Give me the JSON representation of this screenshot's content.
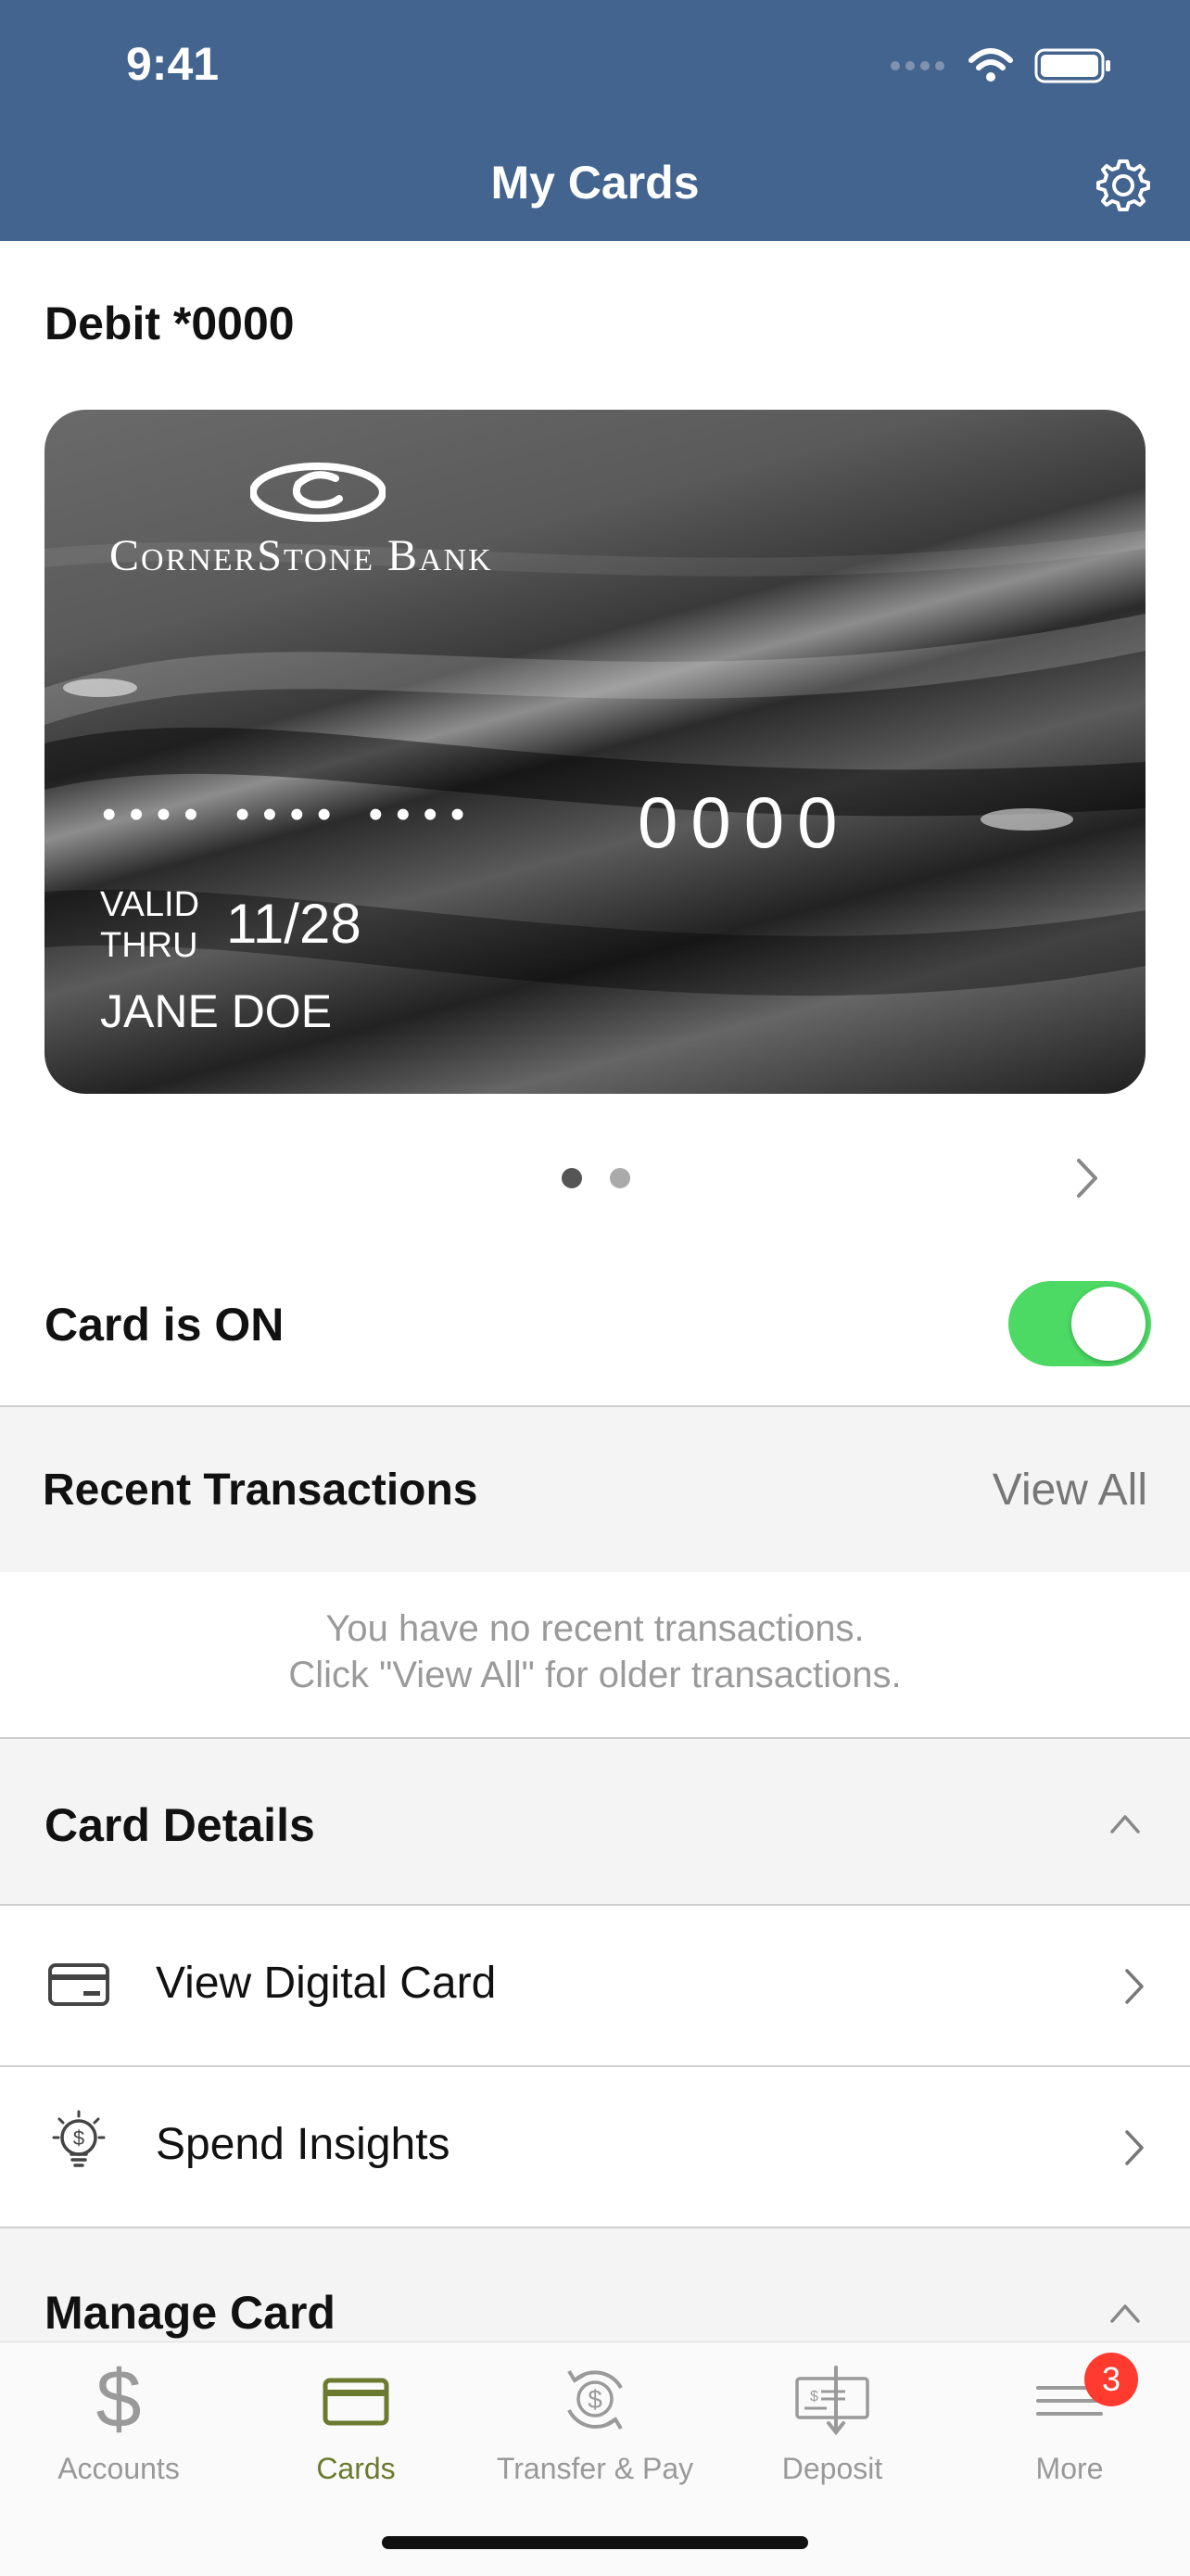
{
  "status_bar": {
    "time": "9:41"
  },
  "header": {
    "title": "My Cards"
  },
  "card": {
    "label": "Debit *0000",
    "bank_name": "CornerStone Bank",
    "number_mask": "•••• •••• ••••",
    "last4": "0000",
    "valid_label_1": "VALID",
    "valid_label_2": "THRU",
    "expiry": "11/28",
    "cardholder": "JANE DOE",
    "pager": {
      "count": 2,
      "active_index": 0
    }
  },
  "card_status": {
    "label": "Card is ON",
    "enabled": true
  },
  "recent_transactions": {
    "title": "Recent Transactions",
    "view_all": "View All",
    "empty_line_1": "You have no recent transactions.",
    "empty_line_2": "Click \"View All\" for older transactions."
  },
  "card_details": {
    "title": "Card Details",
    "items": [
      {
        "label": "View Digital Card",
        "icon": "credit-card-icon"
      },
      {
        "label": "Spend Insights",
        "icon": "lightbulb-dollar-icon"
      }
    ]
  },
  "manage_card": {
    "title": "Manage Card"
  },
  "tabbar": {
    "tabs": [
      {
        "label": "Accounts",
        "icon": "dollar-icon",
        "active": false
      },
      {
        "label": "Cards",
        "icon": "card-icon",
        "active": true
      },
      {
        "label": "Transfer & Pay",
        "icon": "transfer-icon",
        "active": false
      },
      {
        "label": "Deposit",
        "icon": "check-deposit-icon",
        "active": false
      },
      {
        "label": "More",
        "icon": "menu-icon",
        "active": false
      }
    ],
    "more_badge": "3"
  },
  "colors": {
    "header_bg": "#42648f",
    "toggle_on": "#4cd964",
    "active_tab": "#6b7a2e",
    "badge": "#ff3b30"
  }
}
